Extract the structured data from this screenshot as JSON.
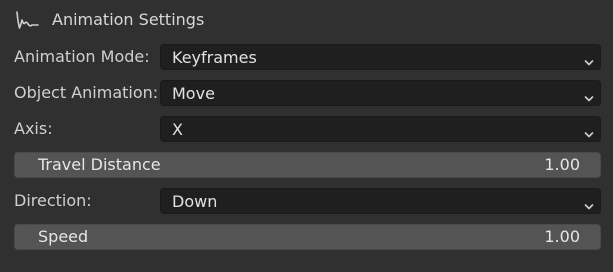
{
  "panel": {
    "title": "Animation Settings",
    "icon": "fcurve-wave-icon"
  },
  "fields": {
    "animation_mode": {
      "label": "Animation Mode:",
      "value": "Keyframes"
    },
    "object_animation": {
      "label": "Object Animation:",
      "value": "Move"
    },
    "axis": {
      "label": "Axis:",
      "value": "X"
    },
    "travel_distance": {
      "label": "Travel Distance",
      "value": "1.00"
    },
    "direction": {
      "label": "Direction:",
      "value": "Down"
    },
    "speed": {
      "label": "Speed",
      "value": "1.00"
    }
  },
  "colors": {
    "panel_background": "#303030",
    "dropdown_background": "#1f1f1f",
    "slider_background": "#545454",
    "text": "#d6d6d6"
  }
}
